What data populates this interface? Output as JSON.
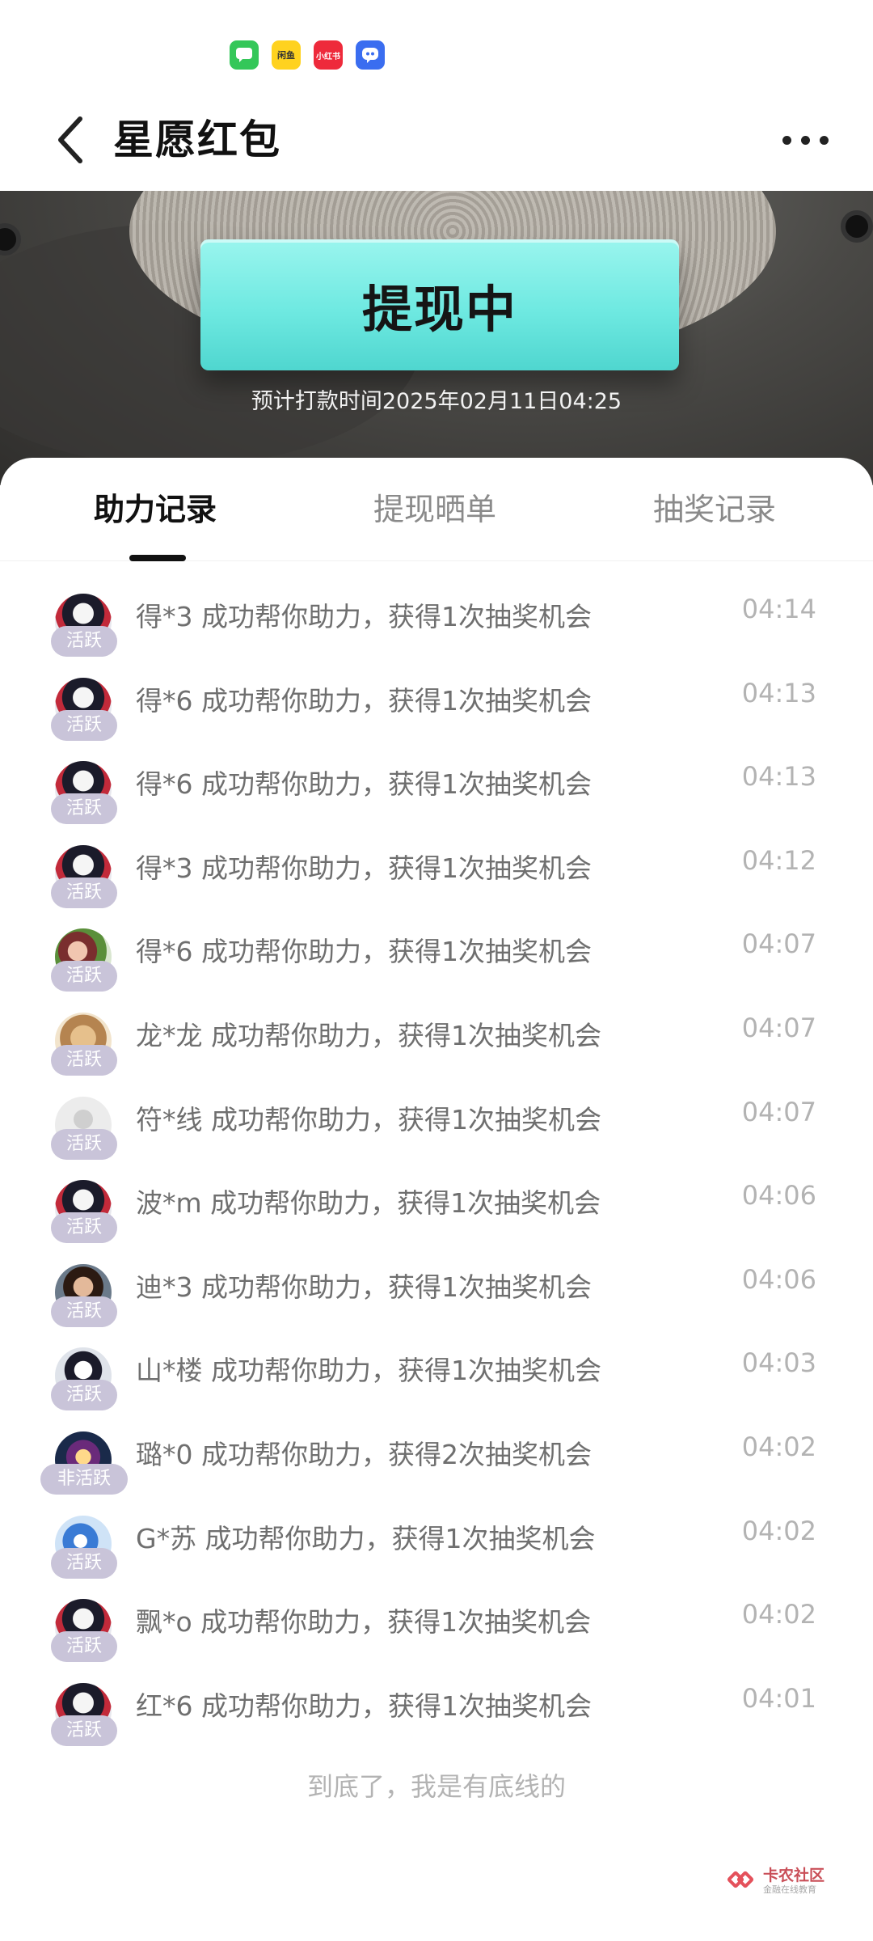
{
  "nav": {
    "title": "星愿红包"
  },
  "banner": {
    "status": "提现中",
    "payout_time": "预计打款时间2025年02月11日04:25"
  },
  "tabs": [
    {
      "label": "助力记录",
      "active": true
    },
    {
      "label": "提现晒单",
      "active": false
    },
    {
      "label": "抽奖记录",
      "active": false
    }
  ],
  "records": [
    {
      "text": "得*3 成功帮你助力，获得1次抽奖机会",
      "time": "04:14",
      "badge": "活跃"
    },
    {
      "text": "得*6 成功帮你助力，获得1次抽奖机会",
      "time": "04:13",
      "badge": "活跃"
    },
    {
      "text": "得*6 成功帮你助力，获得1次抽奖机会",
      "time": "04:13",
      "badge": "活跃"
    },
    {
      "text": "得*3 成功帮你助力，获得1次抽奖机会",
      "time": "04:12",
      "badge": "活跃"
    },
    {
      "text": "得*6 成功帮你助力，获得1次抽奖机会",
      "time": "04:07",
      "badge": "活跃"
    },
    {
      "text": "龙*龙 成功帮你助力，获得1次抽奖机会",
      "time": "04:07",
      "badge": "活跃"
    },
    {
      "text": "符*线 成功帮你助力，获得1次抽奖机会",
      "time": "04:07",
      "badge": "活跃"
    },
    {
      "text": "波*m 成功帮你助力，获得1次抽奖机会",
      "time": "04:06",
      "badge": "活跃"
    },
    {
      "text": "迪*3 成功帮你助力，获得1次抽奖机会",
      "time": "04:06",
      "badge": "活跃"
    },
    {
      "text": "山*楼 成功帮你助力，获得1次抽奖机会",
      "time": "04:03",
      "badge": "活跃"
    },
    {
      "text": "璐*0 成功帮你助力，获得2次抽奖机会",
      "time": "04:02",
      "badge": "非活跃"
    },
    {
      "text": "G*苏 成功帮你助力，获得1次抽奖机会",
      "time": "04:02",
      "badge": "活跃"
    },
    {
      "text": "飘*o 成功帮你助力，获得1次抽奖机会",
      "time": "04:02",
      "badge": "活跃"
    },
    {
      "text": "红*6 成功帮你助力，获得1次抽奖机会",
      "time": "04:01",
      "badge": "活跃"
    }
  ],
  "list_footer": "到底了，我是有底线的",
  "watermark": {
    "title": "卡农社区",
    "subtitle": "金融在线教育"
  },
  "status_bar": {
    "icons": [
      "message-icon",
      "app-yellow-icon",
      "xiaohongshu-icon",
      "chat-bot-icon"
    ],
    "icon_labels": {
      "yellow": "闲鱼",
      "red": "小红书"
    }
  },
  "colors": {
    "status_box": "#6ee9e1",
    "badge": "#c9c4d9",
    "time_text": "#b3b3b3"
  }
}
